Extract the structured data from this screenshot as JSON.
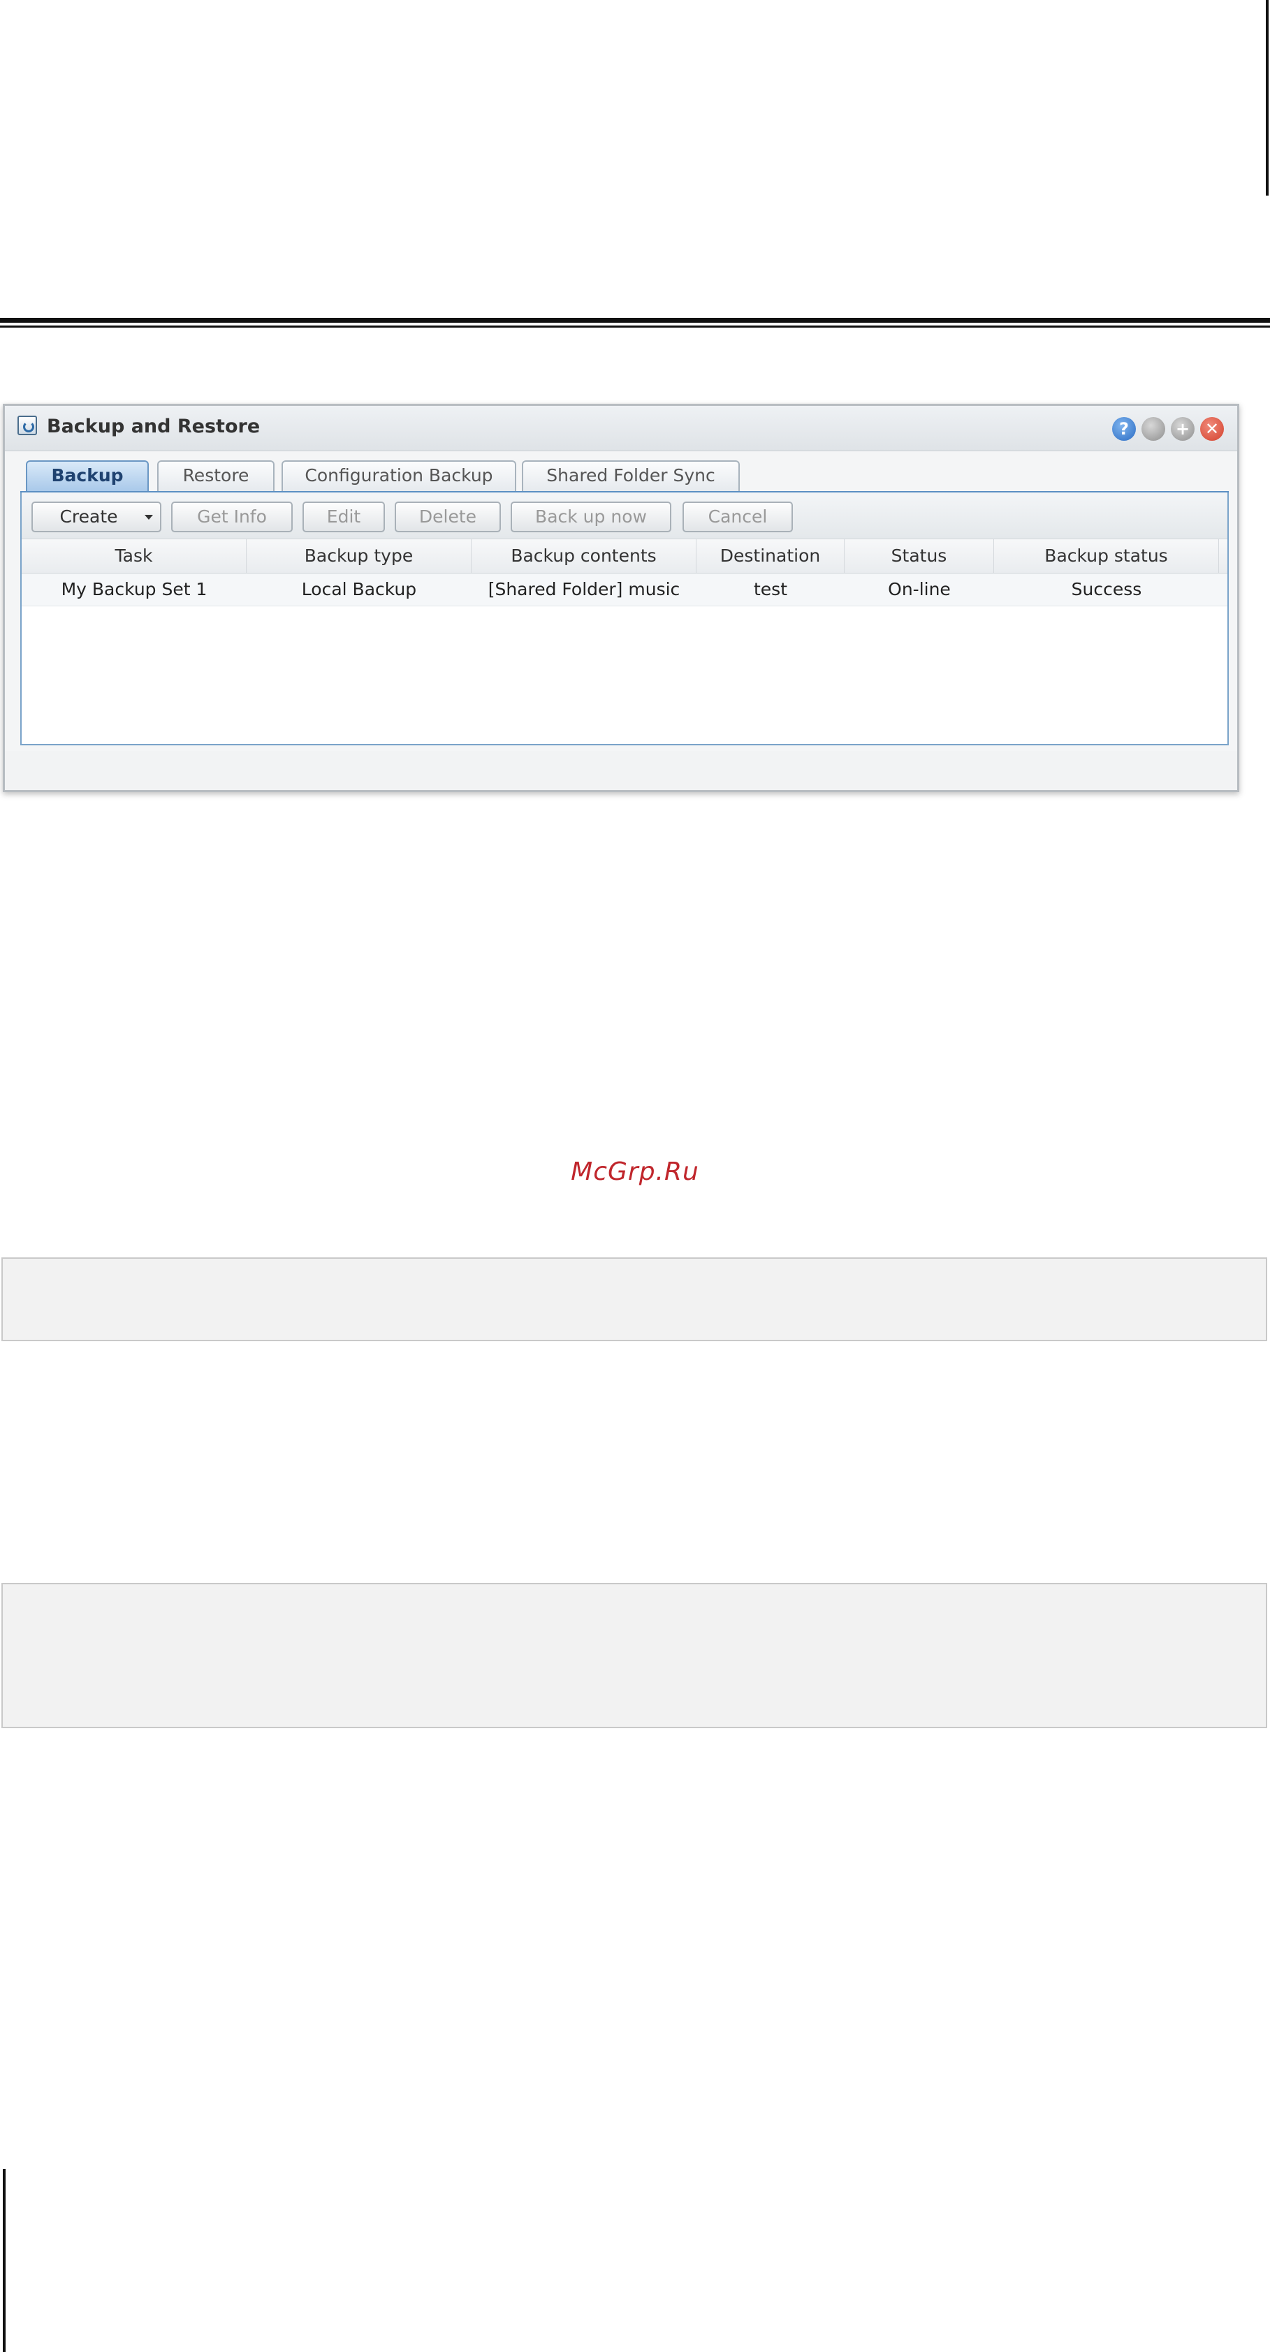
{
  "window": {
    "title": "Backup and Restore",
    "buttons": {
      "help": "?",
      "minimize": "",
      "maximize": "+",
      "close": "✕"
    }
  },
  "tabs": [
    "Backup",
    "Restore",
    "Configuration Backup",
    "Shared Folder Sync"
  ],
  "active_tab": "Backup",
  "toolbar": {
    "create": "Create",
    "get_info": "Get Info",
    "edit": "Edit",
    "delete": "Delete",
    "back_up_now": "Back up now",
    "cancel": "Cancel"
  },
  "table": {
    "columns": [
      "Task",
      "Backup type",
      "Backup contents",
      "Destination",
      "Status",
      "Backup status"
    ],
    "rows": [
      [
        "My Backup Set 1",
        "Local Backup",
        "[Shared Folder] music",
        "test",
        "On-line",
        "Success"
      ]
    ]
  },
  "watermark": "McGrp.Ru",
  "colors": {
    "accent": "#5b8fc3",
    "active_tab": "#a9c9ea",
    "watermark": "#c0262c",
    "note_box": "#f2f2f2"
  },
  "icons": [
    "backup-restore-app-icon",
    "help-icon",
    "minimize-icon",
    "maximize-icon",
    "close-icon",
    "dropdown-caret-icon"
  ]
}
